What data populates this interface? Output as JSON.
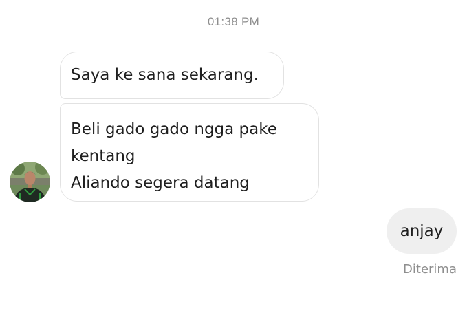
{
  "thread": {
    "timestamp": "01:38 PM"
  },
  "messages": {
    "incoming": [
      {
        "lines": [
          "Saya ke sana sekarang."
        ]
      },
      {
        "lines": [
          "Beli gado gado ngga pake",
          "kentang",
          "Aliando segera datang"
        ]
      }
    ],
    "outgoing": [
      {
        "text": "anjay",
        "status": "Diterima"
      }
    ]
  },
  "sender": {
    "avatar_icon": "profile-photo"
  }
}
